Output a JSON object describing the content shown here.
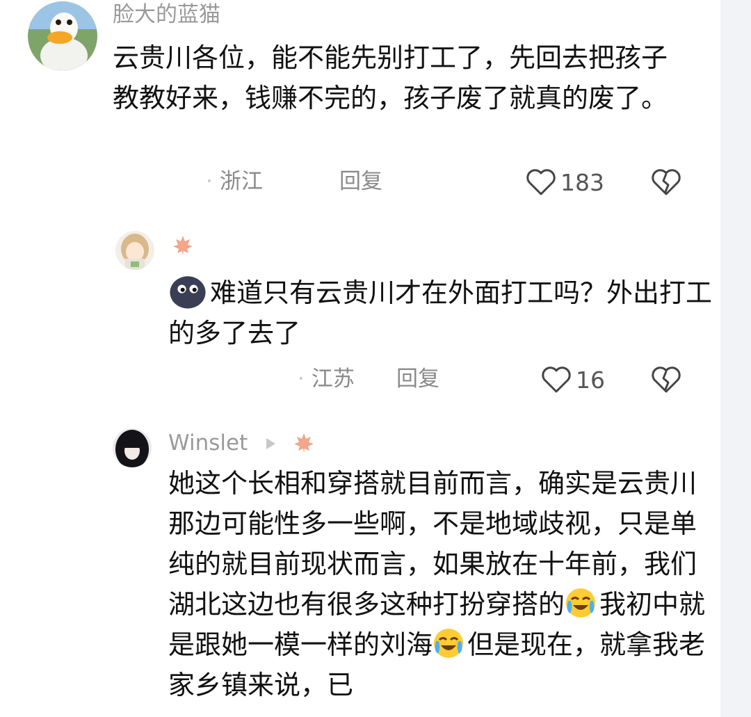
{
  "comments": [
    {
      "username": "脸大的蓝猫",
      "text": "云贵川各位，能不能先别打工了，先回去把孩子教教好来，钱赚不完的，孩子废了就真的废了。",
      "location": "浙江",
      "reply_label": "回复",
      "likes": "183"
    },
    {
      "username": "",
      "text": "难道只有云贵川才在外面打工吗？外出打工的多了去了",
      "location": "江苏",
      "reply_label": "回复",
      "likes": "16"
    },
    {
      "username": "Winslet",
      "text_part1": "她这个长相和穿搭就目前而言，确实是云贵川那边可能性多一些啊，不是地域歧视，只是单纯的就目前现状而言，如果放在十年前，我们湖北这边也有很多这种打扮穿搭的",
      "text_part2": "我初中就是跟她一模一样的刘海",
      "text_part3": "但是现在，就拿我老家乡镇来说，已"
    }
  ],
  "icons": {
    "like": "heart-outline-icon",
    "dislike": "broken-heart-icon",
    "badge": "maple-leaf-icon",
    "emoji": "crying-laughing-emoji"
  },
  "colors": {
    "badge": "#f4a58a",
    "meta": "#8a8a8a",
    "username": "#9a9a9a"
  }
}
